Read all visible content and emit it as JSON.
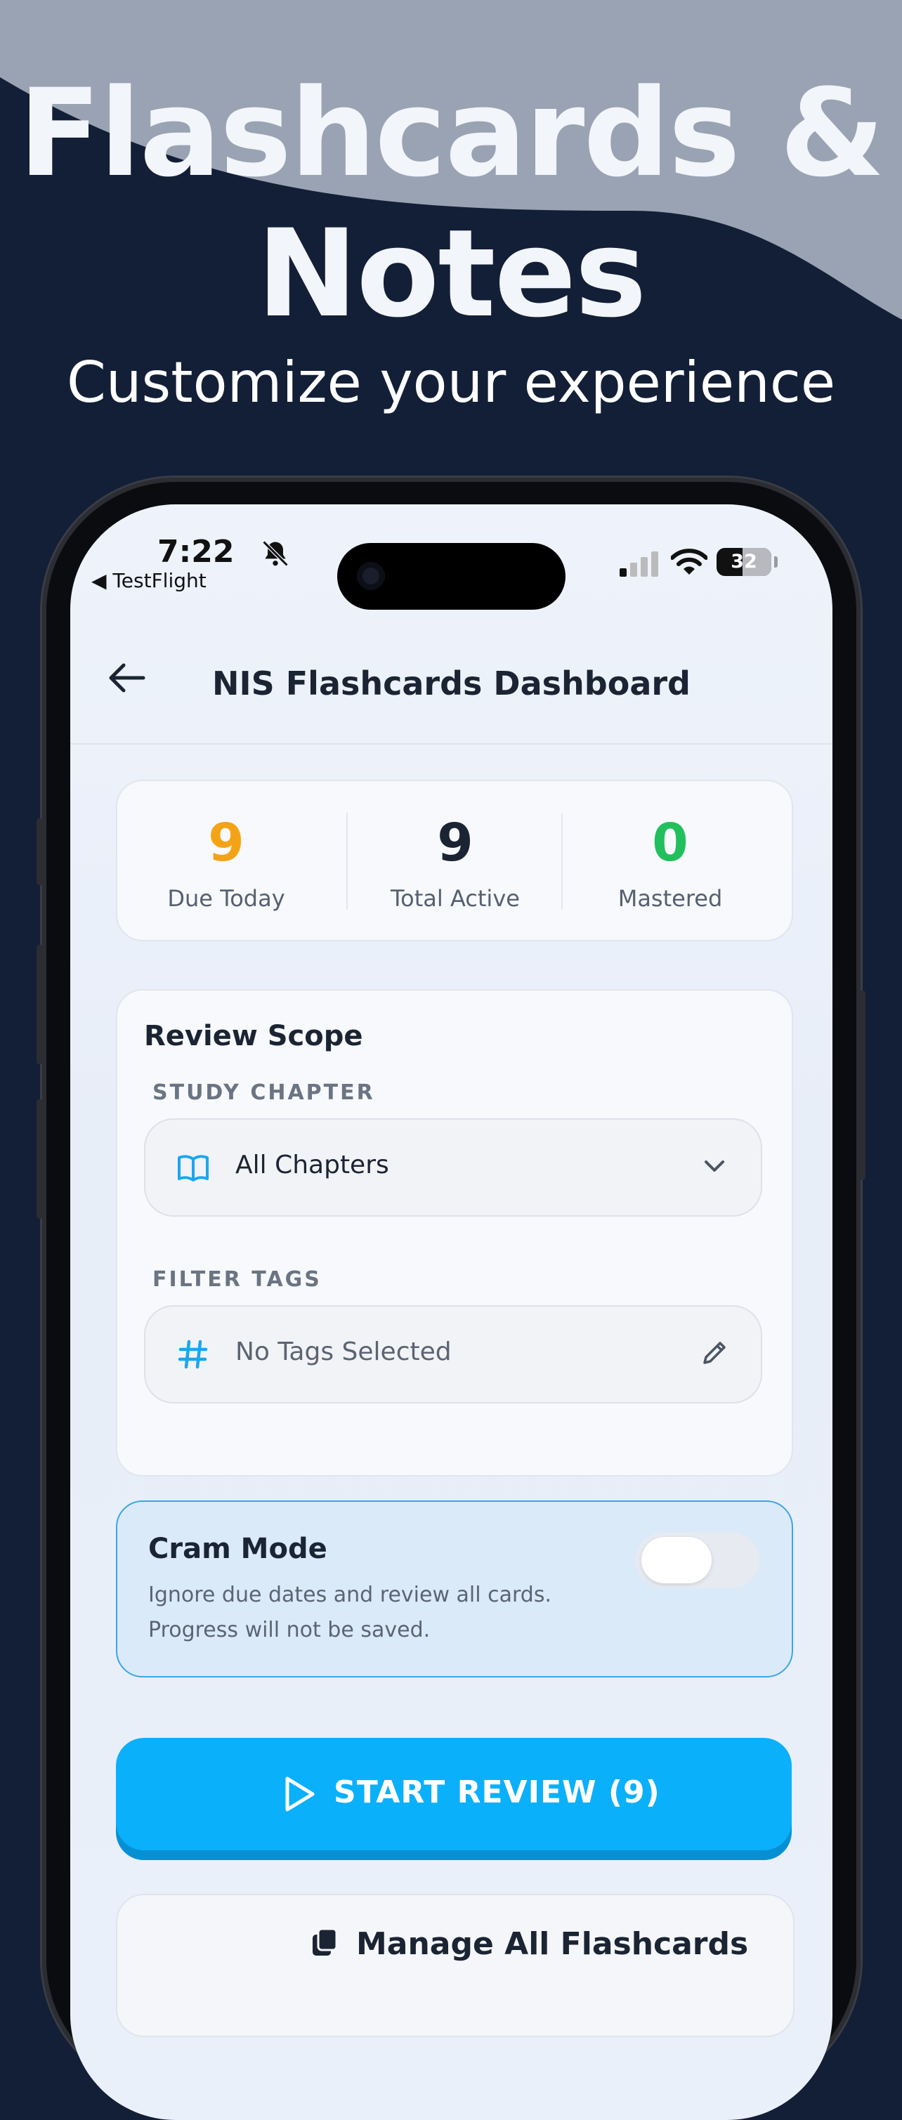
{
  "promo": {
    "headline_line1": "Flashcards &",
    "headline_line2": "Notes",
    "subheadline": "Customize your experience"
  },
  "status_bar": {
    "time": "7:22",
    "back_app": "◀ TestFlight",
    "battery": "32"
  },
  "nav": {
    "title": "NIS Flashcards Dashboard"
  },
  "stats": [
    {
      "value": "9",
      "label": "Due Today",
      "color": "#f5a316"
    },
    {
      "value": "9",
      "label": "Total Active",
      "color": "#1b2433"
    },
    {
      "value": "0",
      "label": "Mastered",
      "color": "#22c05d"
    }
  ],
  "review_scope": {
    "title": "Review Scope",
    "chapter_label": "STUDY CHAPTER",
    "chapter_value": "All Chapters",
    "tags_label": "FILTER TAGS",
    "tags_value": "No Tags Selected"
  },
  "cram_mode": {
    "title": "Cram Mode",
    "description_line1": "Ignore due dates and review all cards.",
    "description_line2": "Progress will not be saved.",
    "enabled": false
  },
  "actions": {
    "start_review": "START REVIEW (9)",
    "manage_all": "Manage All Flashcards"
  },
  "colors": {
    "accent": "#0bb0fb",
    "background": "#131f36"
  }
}
